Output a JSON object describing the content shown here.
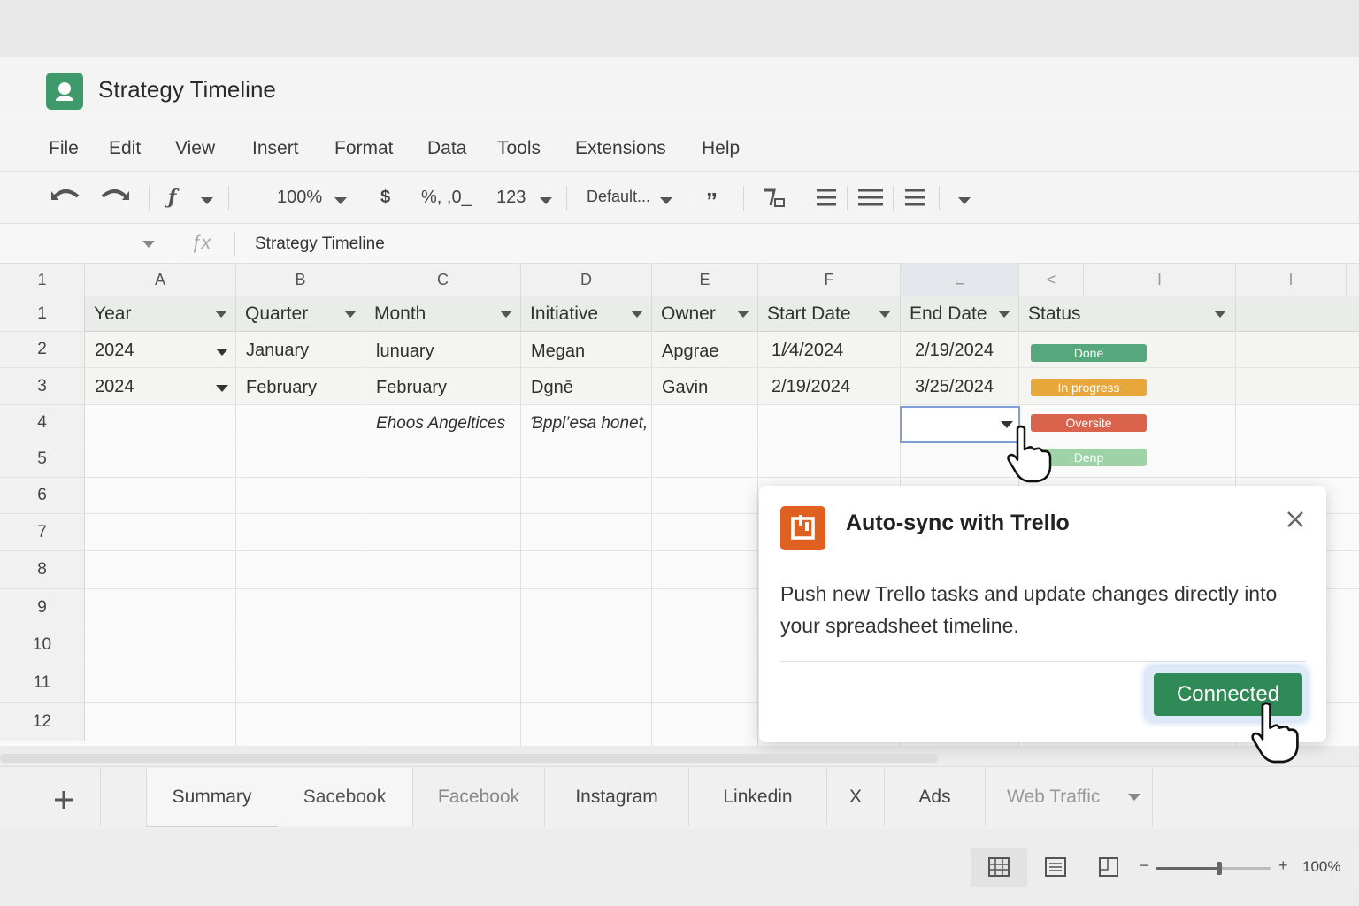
{
  "app": {
    "title": "Strategy Timeline"
  },
  "menu": [
    "File",
    "Edit",
    "View",
    "Insert",
    "Format",
    "Data",
    "Tools",
    "Extensions",
    "Help"
  ],
  "toolbar": {
    "zoom": "100%",
    "currency": "$",
    "percent_decimal": "%, ,0_",
    "format_123": "123",
    "font": "Default...",
    "quote": "”"
  },
  "formula_bar": {
    "fx": "ƒx",
    "content": "Strategy Timeline"
  },
  "grid": {
    "column_letters": [
      "A",
      "B",
      "C",
      "D",
      "E",
      "F",
      "⨽",
      "<",
      "I",
      "I"
    ],
    "row_numbers": [
      "1",
      "1",
      "2",
      "3",
      "4",
      "5",
      "6",
      "7",
      "8",
      "9",
      "10",
      "11",
      "12"
    ],
    "headers": [
      "Year",
      "Quarter",
      "Month",
      "Initiative",
      "Owner",
      "Start Date",
      "End Date",
      "Status"
    ],
    "rows": [
      {
        "year": "2024",
        "quarter": "January",
        "month": "lunuary",
        "initiative": "Megan",
        "owner": "Apgrae",
        "start": "1/⁄4/2024",
        "end": "2/19/2024",
        "status": "Done"
      },
      {
        "year": "2024",
        "quarter": "February",
        "month": "February",
        "initiative": "Dgnē",
        "owner": "Gavin",
        "start": "2/19/2024",
        "end": "3/25/2024",
        "status": "In progress"
      },
      {
        "month": "Ehoos Angeltices",
        "initiative": "Ɓppl’esa honet,",
        "status": "Oversite"
      },
      {
        "status": "Denp"
      }
    ],
    "status_colors": {
      "done": "#56a77b",
      "in_progress": "#e8a73a",
      "oversite": "#d9634c",
      "denp": "#9ed3a8"
    }
  },
  "popup": {
    "title": "Auto-sync with Trello",
    "body": "Push new Trello tasks and update changes directly into your spreadsheet timeline.",
    "button": "Connected",
    "accent": "#e0611f"
  },
  "sheets": [
    "Summary",
    "Sacebook",
    "Facebook",
    "Instagram",
    "Linkedin",
    "X",
    "Ads",
    "Web Traffic"
  ],
  "status_bar": {
    "zoom": "100%",
    "zoom_level": 0.55
  }
}
